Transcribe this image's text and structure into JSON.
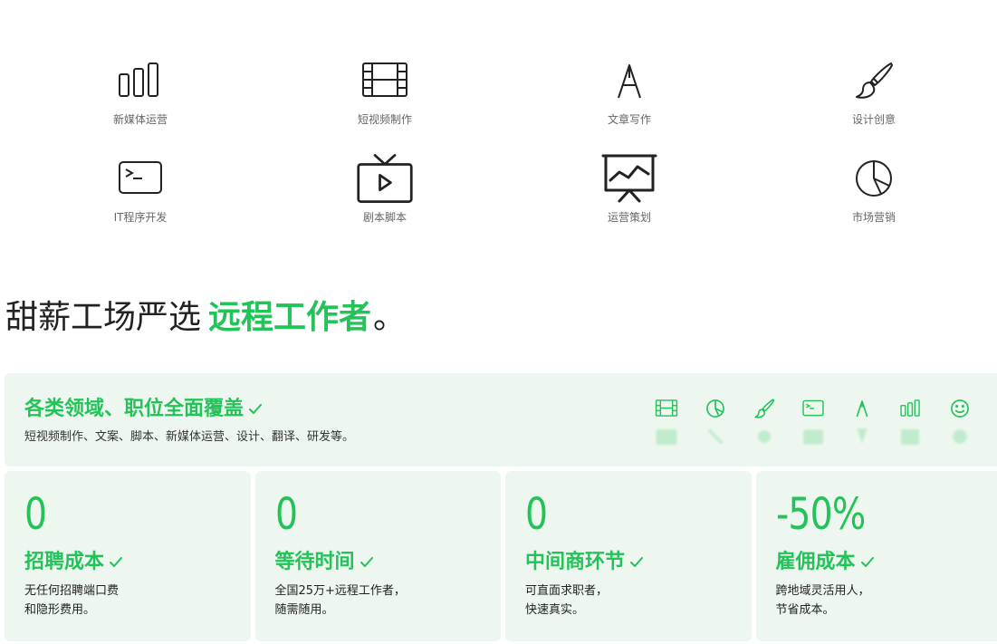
{
  "categories": [
    {
      "label": "新媒体运营",
      "icon": "bar-chart-icon"
    },
    {
      "label": "短视频制作",
      "icon": "film-icon"
    },
    {
      "label": "文章写作",
      "icon": "pen-nib-icon"
    },
    {
      "label": "设计创意",
      "icon": "paintbrush-icon"
    },
    {
      "label": "IT程序开发",
      "icon": "terminal-icon"
    },
    {
      "label": "剧本脚本",
      "icon": "tv-play-icon"
    },
    {
      "label": "运营策划",
      "icon": "presentation-chart-icon"
    },
    {
      "label": "市场营销",
      "icon": "pie-chart-icon"
    }
  ],
  "headline": {
    "prefix": "甜薪工场严选",
    "highlight": "远程工作者",
    "suffix": "。"
  },
  "banner": {
    "title": "各类领域、职位全面覆盖",
    "description": "短视频制作、文案、脚本、新媒体运营、设计、翻译、研发等。",
    "icons": [
      "film-icon",
      "pie-chart-icon",
      "paintbrush-icon",
      "terminal-icon",
      "pen-nib-icon",
      "bar-chart-icon",
      "smiley-icon"
    ]
  },
  "stats": [
    {
      "value": "0",
      "title": "招聘成本",
      "desc_line1": "无任何招聘端口费",
      "desc_line2": "和隐形费用。"
    },
    {
      "value": "0",
      "title": "等待时间",
      "desc_line1": "全国25万+远程工作者，",
      "desc_line2": "随需随用。"
    },
    {
      "value": "0",
      "title": "中间商环节",
      "desc_line1": "可直面求职者，",
      "desc_line2": "快速真实。"
    },
    {
      "value": "-50%",
      "title": "雇佣成本",
      "desc_line1": "跨地域灵活用人，",
      "desc_line2": "节省成本。"
    }
  ],
  "colors": {
    "accent": "#23c35a",
    "card_bg": "#eef7ef",
    "icon_stroke": "#222222"
  }
}
